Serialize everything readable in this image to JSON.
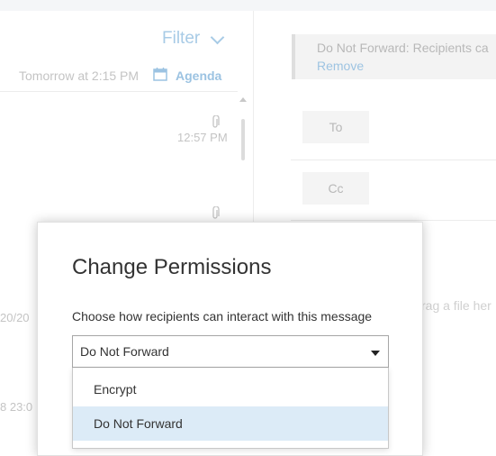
{
  "list": {
    "filter_label": "Filter",
    "subheader_text": "Tomorrow at 2:15 PM",
    "agenda_label": "Agenda",
    "items": [
      {
        "time": "12:57 PM"
      },
      {
        "date": "20/20"
      },
      {
        "date": "8 23:0"
      }
    ]
  },
  "compose": {
    "notice_text": "Do Not Forward: Recipients ca",
    "remove_label": "Remove",
    "to_label": "To",
    "cc_label": "Cc",
    "drag_hint": "rag a file her"
  },
  "modal": {
    "title": "Change Permissions",
    "description": "Choose how recipients can interact with this message",
    "selected_value": "Do Not Forward",
    "options": [
      {
        "label": "Encrypt"
      },
      {
        "label": "Do Not Forward"
      }
    ]
  },
  "colors": {
    "accent_light": "#9ec4e2",
    "selected_option_bg": "#dcebf7"
  }
}
